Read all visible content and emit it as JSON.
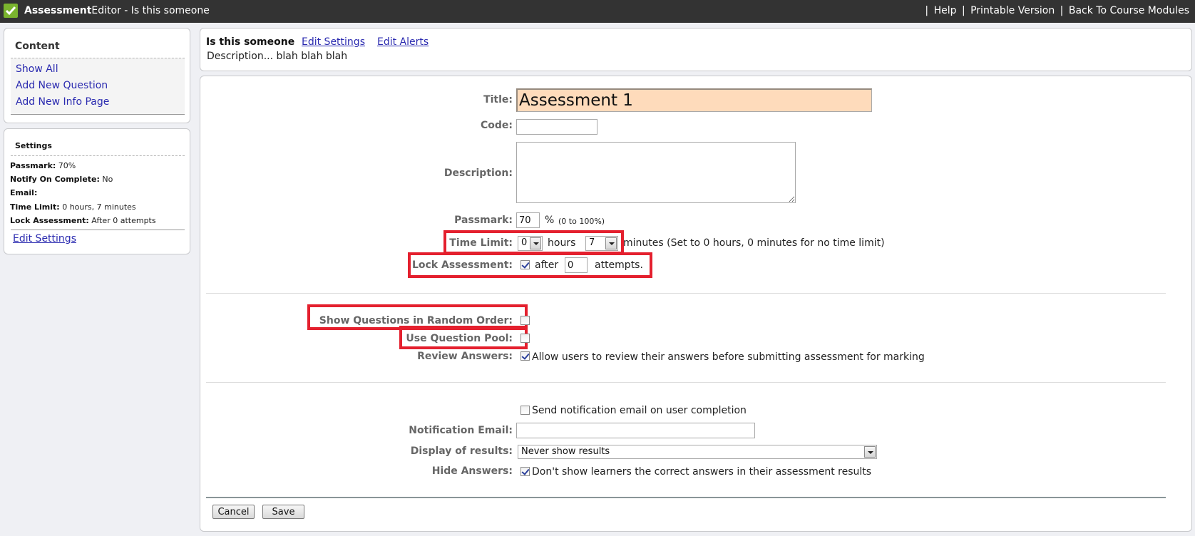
{
  "topbar": {
    "app_name_bold": "Assessment",
    "app_name_rest": "Editor - Is this someone",
    "links": [
      {
        "label": "Help"
      },
      {
        "label": "Printable Version"
      },
      {
        "label": "Back To Course Modules"
      }
    ],
    "separator": "|",
    "logo_icon": "check-icon",
    "logo_color": "#7ab32e"
  },
  "sidebar": {
    "content": {
      "heading": "Content",
      "items": [
        {
          "label": "Show All"
        },
        {
          "label": "Add New Question"
        },
        {
          "label": "Add New Info Page"
        }
      ]
    },
    "settings": {
      "heading": "Settings",
      "rows": [
        {
          "key": "Passmark:",
          "value": " 70%"
        },
        {
          "key": "Notify On Complete:",
          "value": " No"
        },
        {
          "key": "Email:",
          "value": ""
        },
        {
          "key": "Time Limit:",
          "value": " 0 hours, 7 minutes"
        },
        {
          "key": "Lock Assessment:",
          "value": " After 0 attempts"
        }
      ],
      "edit_link": "Edit Settings"
    }
  },
  "header": {
    "assessment_name": "Is this someone",
    "edit_settings": "Edit Settings",
    "edit_alerts": "Edit Alerts",
    "description": "Description... blah blah blah"
  },
  "form": {
    "title": {
      "label": "Title:",
      "value": "Assessment 1"
    },
    "code": {
      "label": "Code:",
      "value": ""
    },
    "description": {
      "label": "Description:",
      "value": ""
    },
    "passmark": {
      "label": "Passmark:",
      "value": "70",
      "unit": "%",
      "hint": "(0 to 100%)"
    },
    "time_limit": {
      "label": "Time Limit:",
      "hours": "0",
      "hours_label": "hours",
      "minutes": "7",
      "hint": "minutes (Set to 0 hours, 0 minutes for no time limit)"
    },
    "lock_assessment": {
      "label": "Lock Assessment:",
      "checked": true,
      "after_label": "after",
      "attempts": "0",
      "attempts_label": "attempts."
    },
    "random_order": {
      "label": "Show Questions in Random Order:",
      "checked": false
    },
    "question_pool": {
      "label": "Use Question Pool:",
      "checked": false
    },
    "review_answers": {
      "label": "Review Answers:",
      "checked": true,
      "text": "Allow users to review their answers before submitting assessment for marking"
    },
    "send_notification": {
      "checked": false,
      "text": "Send notification email on user completion"
    },
    "notification_email": {
      "label": "Notification Email:",
      "value": ""
    },
    "display_results": {
      "label": "Display of results:",
      "selected": "Never show results"
    },
    "hide_answers": {
      "label": "Hide Answers:",
      "checked": true,
      "text": "Don't show learners the correct answers in their assessment results"
    },
    "cancel_label": "Cancel",
    "save_label": "Save"
  },
  "colors": {
    "highlight": "#e4202e",
    "title_input_bg": "#fedbbb",
    "topbar_bg": "#333333",
    "link": "#2b2bb0"
  }
}
